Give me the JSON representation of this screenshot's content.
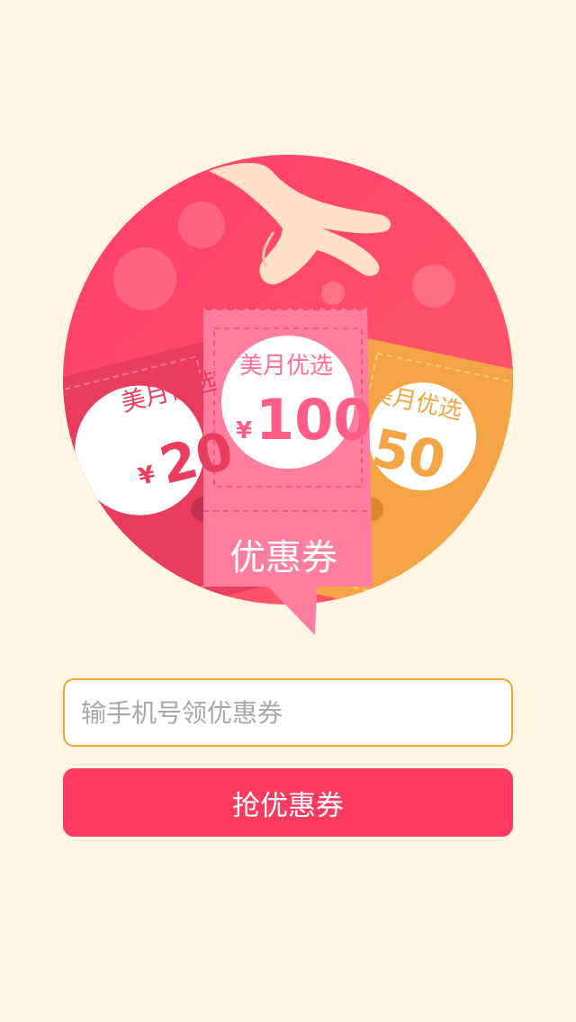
{
  "hero": {
    "left_coupon": {
      "brand": "美月优选",
      "currency": "¥",
      "amount": "20"
    },
    "center_coupon": {
      "brand": "美月优选",
      "currency": "¥",
      "amount": "100"
    },
    "right_coupon": {
      "brand": "美月优选",
      "amount": "50"
    },
    "banner_label": "优惠券"
  },
  "form": {
    "phone_placeholder": "输手机号领优惠券",
    "submit_label": "抢优惠券"
  },
  "colors": {
    "background": "#fff5e3",
    "accent": "#f93b5f",
    "input_border": "#f1a531"
  },
  "icons": [
    "hand-icon",
    "coupon-ticket-icon"
  ]
}
